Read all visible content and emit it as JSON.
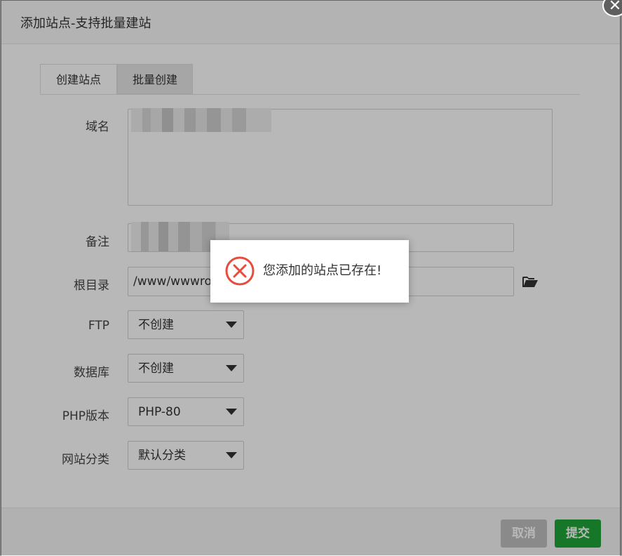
{
  "dialog": {
    "title": "添加站点-支持批量建站",
    "close_icon": "close-icon"
  },
  "tabs": [
    {
      "label": "创建站点",
      "active": true
    },
    {
      "label": "批量创建",
      "active": false
    }
  ],
  "form": {
    "domain_label": "域名",
    "remark_label": "备注",
    "root_label": "根目录",
    "root_value": "/www/wwwroo",
    "ftp_label": "FTP",
    "ftp_value": "不创建",
    "db_label": "数据库",
    "db_value": "不创建",
    "php_label": "PHP版本",
    "php_value": "PHP-80",
    "category_label": "网站分类",
    "category_value": "默认分类"
  },
  "footer": {
    "cancel_label": "取消",
    "submit_label": "提交"
  },
  "toast": {
    "message": "您添加的站点已存在!",
    "icon": "error-circle-icon"
  },
  "colors": {
    "primary": "#20a53a",
    "error": "#e74c3c",
    "disabled": "#bfbfbf"
  }
}
